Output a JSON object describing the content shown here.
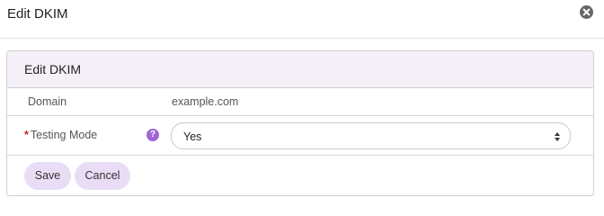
{
  "modal": {
    "title": "Edit DKIM",
    "close_icon": "close-circle-icon"
  },
  "card": {
    "title": "Edit DKIM",
    "domain": {
      "label": "Domain",
      "value": "example.com"
    },
    "testing_mode": {
      "required_marker": "*",
      "label": "Testing Mode",
      "help_glyph": "?",
      "help_icon": "question-circle-icon",
      "selected": "Yes"
    }
  },
  "actions": {
    "save_label": "Save",
    "cancel_label": "Cancel"
  },
  "colors": {
    "card_header_bg": "#f5f0f8",
    "button_bg": "#e9ddf6",
    "help_icon_bg": "#a066d6",
    "required": "#c62828"
  }
}
